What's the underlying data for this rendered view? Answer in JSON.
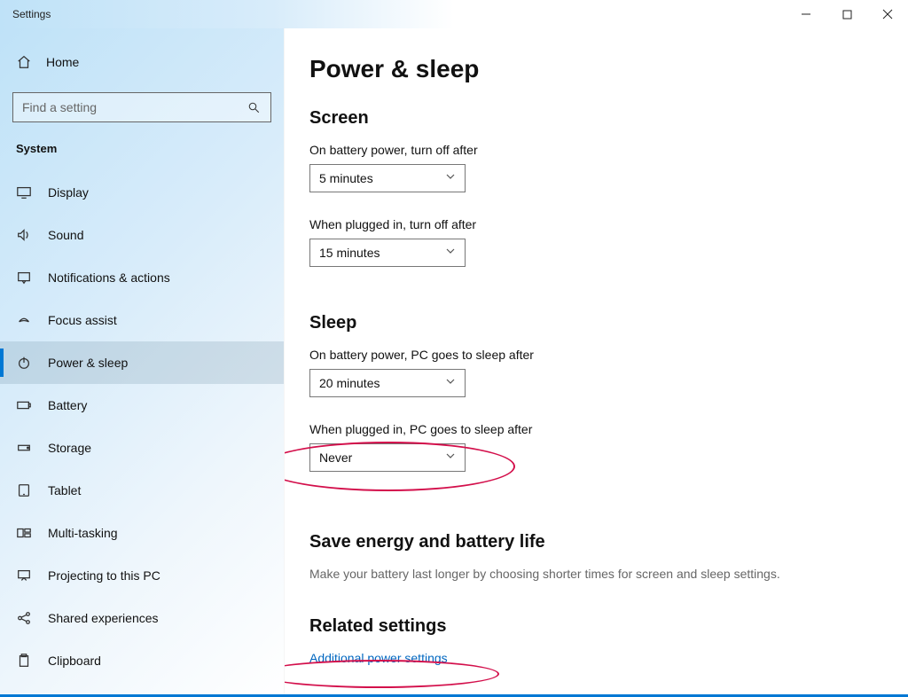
{
  "window": {
    "title": "Settings"
  },
  "sidebar": {
    "home_label": "Home",
    "search_placeholder": "Find a setting",
    "section_label": "System",
    "items": [
      {
        "label": "Display"
      },
      {
        "label": "Sound"
      },
      {
        "label": "Notifications & actions"
      },
      {
        "label": "Focus assist"
      },
      {
        "label": "Power & sleep"
      },
      {
        "label": "Battery"
      },
      {
        "label": "Storage"
      },
      {
        "label": "Tablet"
      },
      {
        "label": "Multi-tasking"
      },
      {
        "label": "Projecting to this PC"
      },
      {
        "label": "Shared experiences"
      },
      {
        "label": "Clipboard"
      }
    ]
  },
  "main": {
    "page_title": "Power & sleep",
    "screen": {
      "heading": "Screen",
      "battery_label": "On battery power, turn off after",
      "battery_value": "5 minutes",
      "plugged_label": "When plugged in, turn off after",
      "plugged_value": "15 minutes"
    },
    "sleep": {
      "heading": "Sleep",
      "battery_label": "On battery power, PC goes to sleep after",
      "battery_value": "20 minutes",
      "plugged_label": "When plugged in, PC goes to sleep after",
      "plugged_value": "Never"
    },
    "save_energy": {
      "heading": "Save energy and battery life",
      "description": "Make your battery last longer by choosing shorter times for screen and sleep settings."
    },
    "related": {
      "heading": "Related settings",
      "link": "Additional power settings"
    }
  }
}
